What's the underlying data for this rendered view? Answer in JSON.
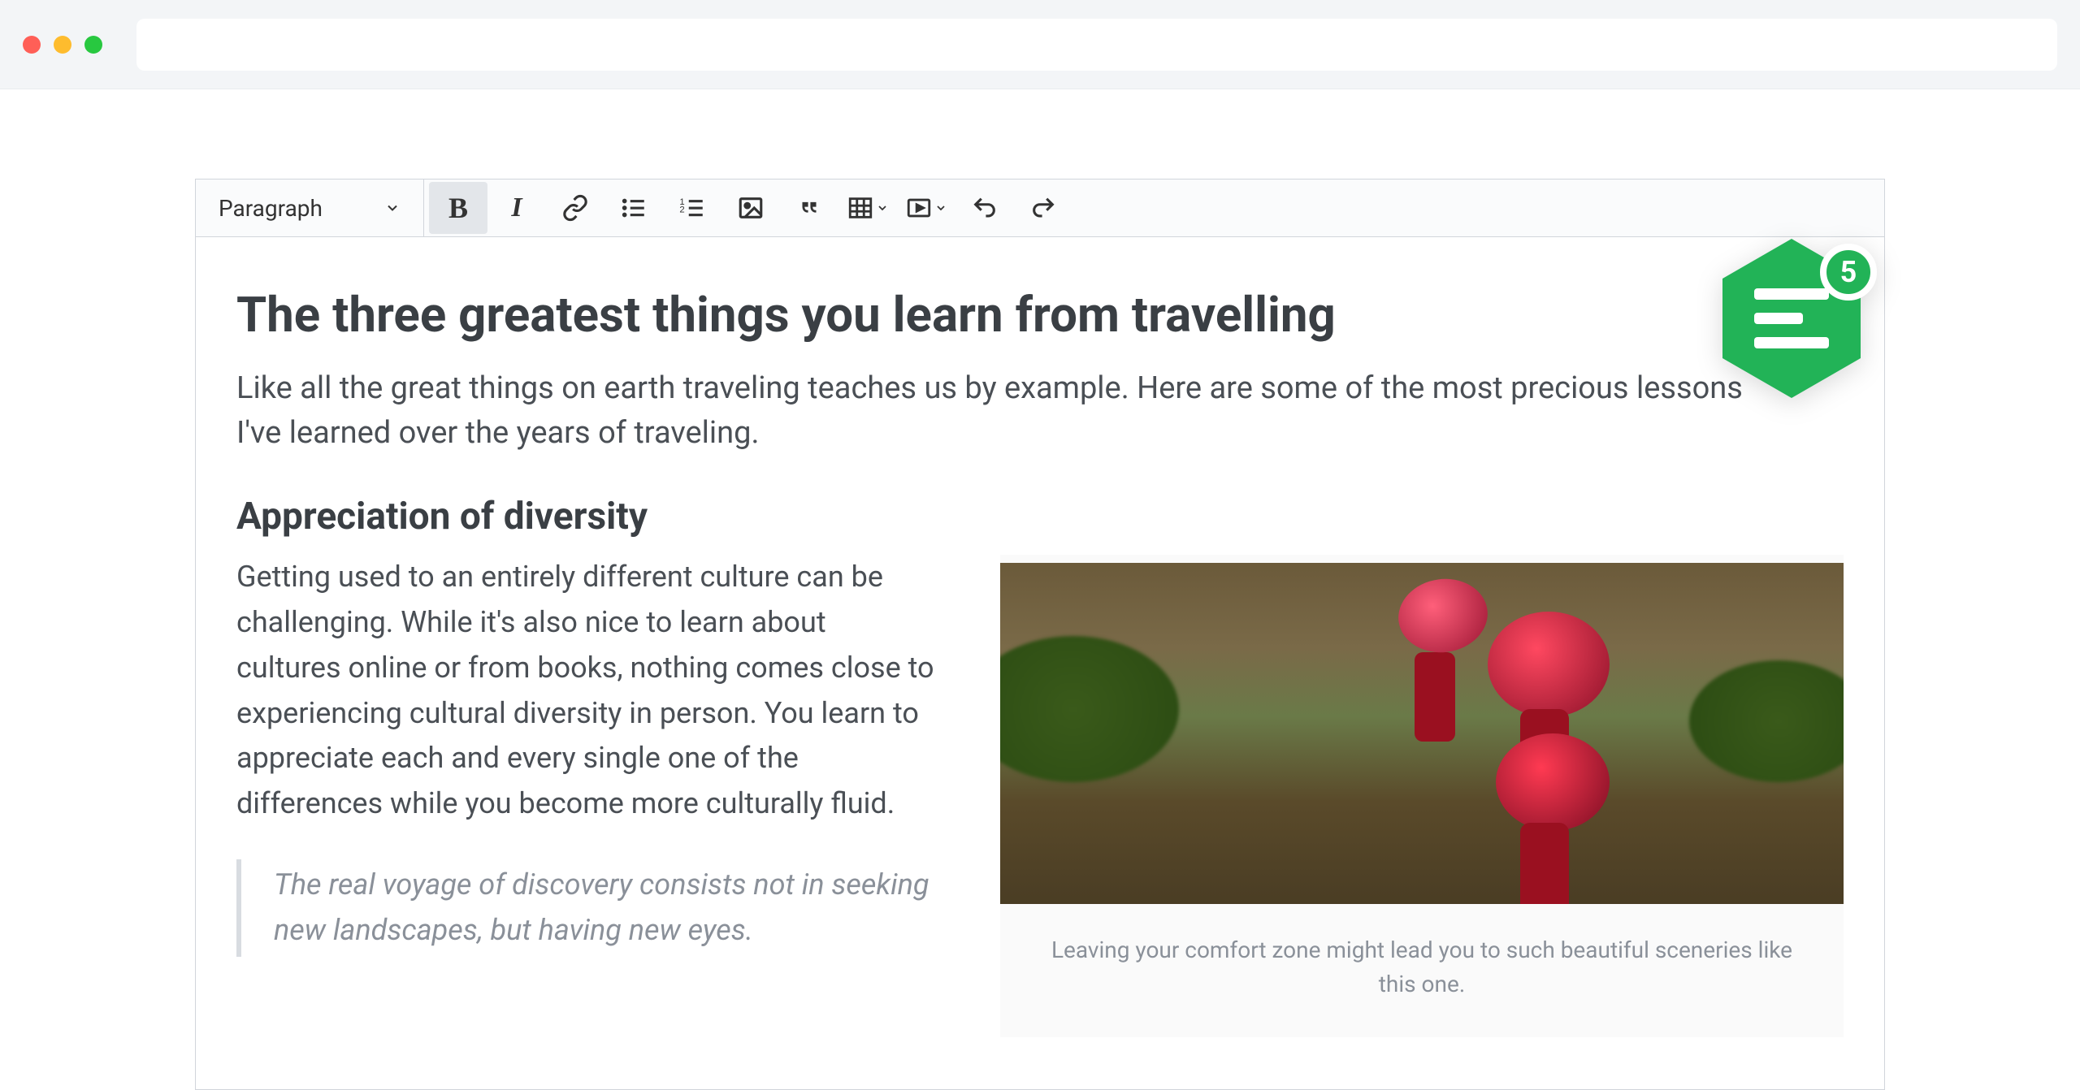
{
  "toolbar": {
    "paragraph_label": "Paragraph",
    "icons": {
      "bold": "bold-icon",
      "italic": "italic-icon",
      "link": "link-icon",
      "bulleted": "bulleted-list-icon",
      "numbered": "numbered-list-icon",
      "image": "image-icon",
      "quote": "blockquote-icon",
      "table": "table-icon",
      "media": "media-icon",
      "undo": "undo-icon",
      "redo": "redo-icon"
    }
  },
  "badge": {
    "count": "5"
  },
  "document": {
    "title": "The three greatest things you learn from travelling",
    "lead": "Like all the great things on earth traveling teaches us by example. Here are some of the most precious lessons I've learned over the years of traveling.",
    "section1": {
      "heading": "Appreciation of diversity",
      "body": "Getting used to an entirely different culture can be challenging. While it's also nice to learn about cultures online or from books, nothing comes close to experiencing cultural diversity in person. You learn to appreciate each and every single one of the differences while you become more culturally fluid.",
      "blockquote": "The real voyage of discovery consists not in seeking new landscapes, but having new eyes."
    },
    "figure": {
      "caption": "Leaving your comfort zone might lead you to such beautiful sceneries like this one.",
      "alt": "monks-with-red-umbrellas-photo"
    }
  }
}
